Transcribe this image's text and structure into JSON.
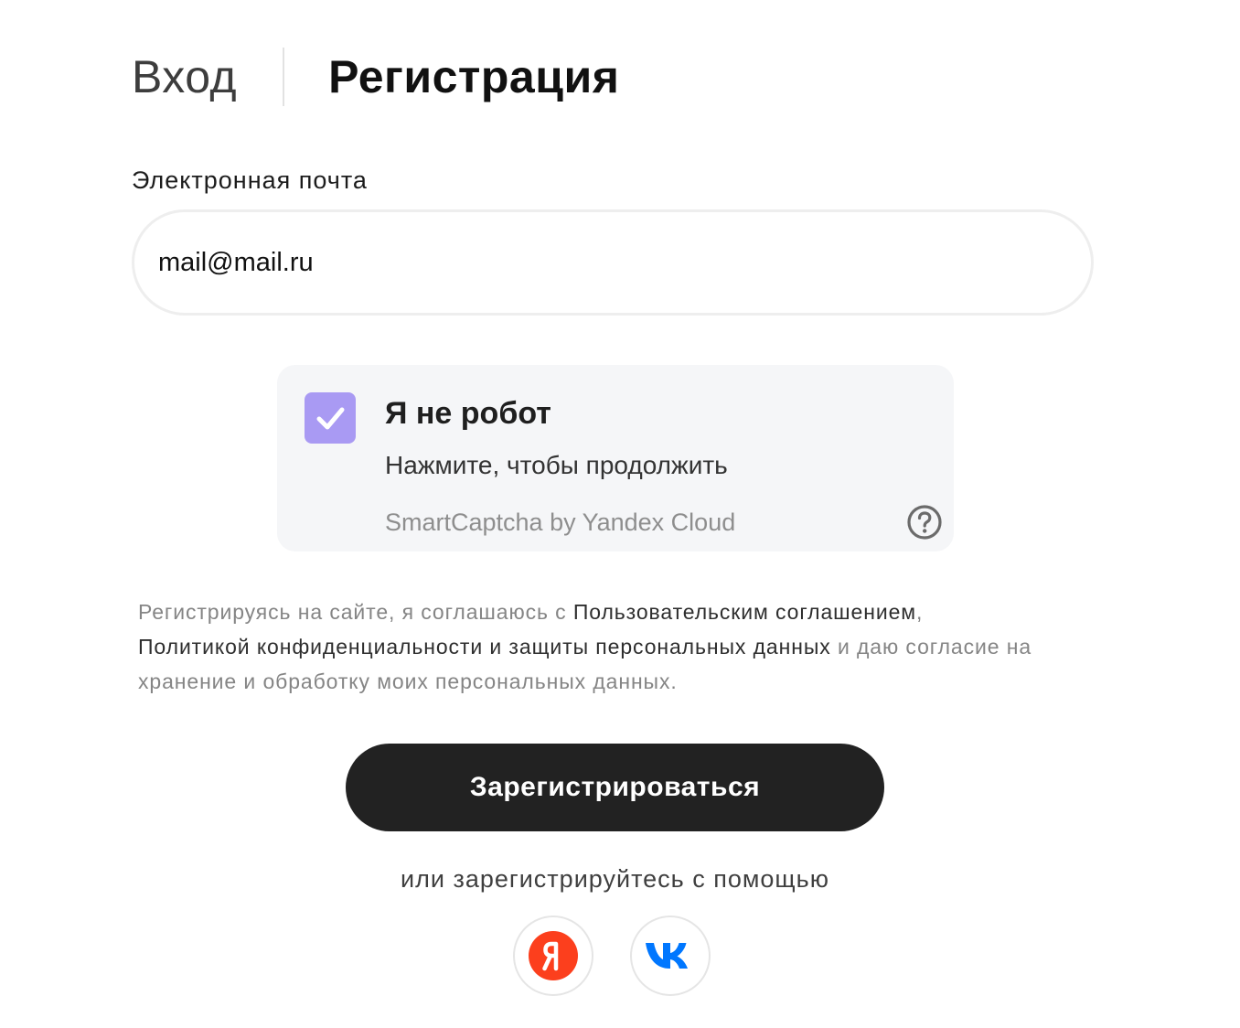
{
  "tabs": {
    "login_label": "Вход",
    "register_label": "Регистрация",
    "active": "register"
  },
  "email": {
    "label": "Электронная почта",
    "value": "mail@mail.ru"
  },
  "captcha": {
    "checked": true,
    "title": "Я не робот",
    "subtitle": "Нажмите, чтобы продолжить",
    "brand": "SmartCaptcha by Yandex Cloud",
    "checkbox_color": "#a99af3",
    "icons": {
      "checkbox": "check-icon",
      "help": "question-circle-icon"
    }
  },
  "consent": {
    "prefix": "Регистрируясь на сайте, я соглашаюсь с ",
    "terms_link": "Пользовательским соглашением",
    "separator": ",",
    "privacy_link": "Политикой конфиденциальности и защиты персональных данных",
    "suffix": " и даю согласие на хранение и обработку моих персональных данных."
  },
  "submit": {
    "label": "Зарегистрироваться"
  },
  "alt_register": {
    "label": "или зарегистрируйтесь с помощью",
    "providers": [
      {
        "name": "Yandex",
        "icon": "yandex-icon",
        "color": "#fc3f1d"
      },
      {
        "name": "VK",
        "icon": "vk-icon",
        "color": "#0077ff"
      }
    ]
  },
  "colors": {
    "button_bg": "#222222",
    "muted_text": "#858585",
    "link_text": "#2e2e2e"
  }
}
